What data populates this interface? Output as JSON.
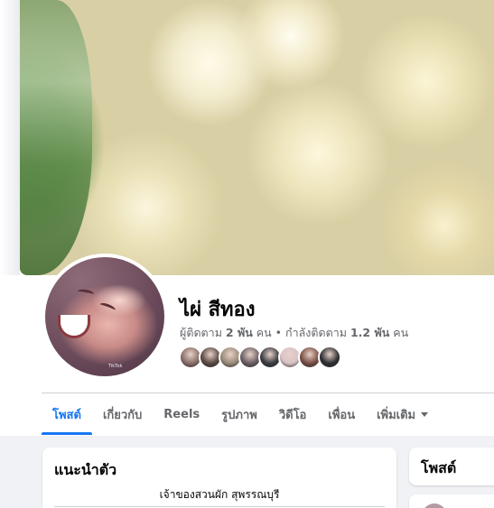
{
  "profile": {
    "name": "ไผ่ สีทอง",
    "followers_count": "2 พัน",
    "followers_label": "ผู้ติดตาม",
    "following_count": "1.2 พัน",
    "following_label": "กำลังติดตาม",
    "unit": "คน",
    "separator": "•",
    "avatar_watermark": "TikTok"
  },
  "friend_avatars": [
    {
      "color": "#8a6f6a"
    },
    {
      "color": "#5d4a45"
    },
    {
      "color": "#9a8c7a"
    },
    {
      "color": "#6b5f64"
    },
    {
      "color": "#3a3c42"
    },
    {
      "color": "#d9c2c6"
    },
    {
      "color": "#7a4f45"
    },
    {
      "color": "#2f2f33"
    }
  ],
  "tabs": [
    {
      "label": "โพสต์",
      "active": true
    },
    {
      "label": "เกี่ยวกับ",
      "active": false
    },
    {
      "label": "Reels",
      "active": false
    },
    {
      "label": "รูปภาพ",
      "active": false
    },
    {
      "label": "วิดีโอ",
      "active": false
    },
    {
      "label": "เพื่อน",
      "active": false
    },
    {
      "label": "เพิ่มเติม",
      "active": false,
      "dropdown": true
    }
  ],
  "intro": {
    "title": "แนะนำตัว",
    "bio": "เจ้าของสวนผัก สุพรรณบุรี"
  },
  "posts": {
    "title": "โพสต์"
  },
  "colors": {
    "accent": "#1877f2",
    "text_primary": "#050505",
    "text_secondary": "#65676b",
    "background": "#f0f2f5"
  }
}
